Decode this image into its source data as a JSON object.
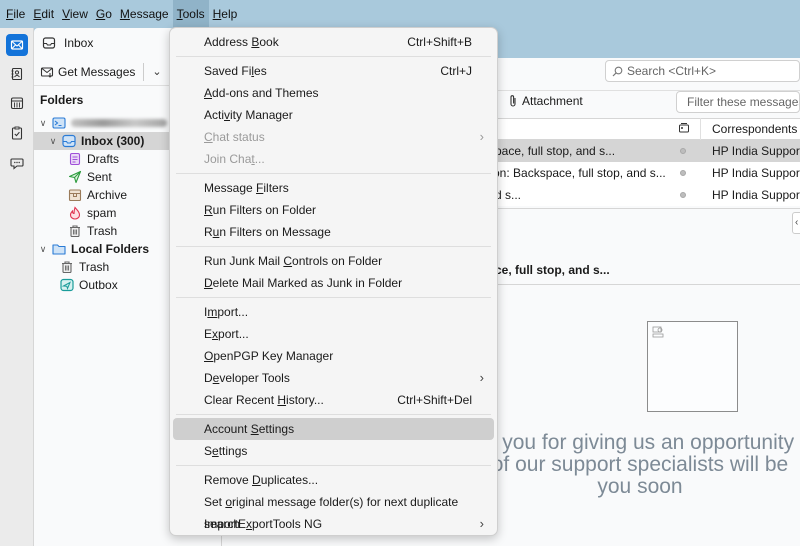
{
  "menubar": {
    "items": [
      {
        "label": "File",
        "mnemonic": "F"
      },
      {
        "label": "Edit",
        "mnemonic": "E"
      },
      {
        "label": "View",
        "mnemonic": "V"
      },
      {
        "label": "Go",
        "mnemonic": "G"
      },
      {
        "label": "Message",
        "mnemonic": "M"
      },
      {
        "label": "Tools",
        "mnemonic": "T"
      },
      {
        "label": "Help",
        "mnemonic": "H"
      }
    ],
    "active": "Tools"
  },
  "spaces": [
    {
      "name": "mail-icon",
      "active": true
    },
    {
      "name": "address-book-icon",
      "active": false
    },
    {
      "name": "calendar-icon",
      "active": false
    },
    {
      "name": "tasks-icon",
      "active": false
    },
    {
      "name": "chat-icon",
      "active": false
    }
  ],
  "tab": {
    "label": "Inbox",
    "icon": "inbox-icon"
  },
  "toolbar": {
    "get_messages": "Get Messages"
  },
  "folder_pane": {
    "header": "Folders",
    "account": {
      "name": "[redacted email]",
      "blurred": true
    },
    "folders": [
      {
        "label": "Inbox (300)",
        "icon": "inbox-icon",
        "level": 1,
        "bold": true,
        "selected": true,
        "expanded": true
      },
      {
        "label": "Drafts",
        "icon": "drafts-icon",
        "level": 2
      },
      {
        "label": "Sent",
        "icon": "sent-icon",
        "level": 2
      },
      {
        "label": "Archive",
        "icon": "archive-icon",
        "level": 2
      },
      {
        "label": "spam",
        "icon": "spam-icon",
        "level": 2
      },
      {
        "label": "Trash",
        "icon": "trash-icon",
        "level": 2
      }
    ],
    "local_folders": {
      "label": "Local Folders",
      "children": [
        {
          "label": "Trash",
          "icon": "trash-icon"
        },
        {
          "label": "Outbox",
          "icon": "outbox-icon"
        }
      ]
    }
  },
  "search": {
    "placeholder": "Search <Ctrl+K>"
  },
  "quick_filter": {
    "attachment_label": "Attachment",
    "filter_placeholder": "Filter these messages <Ctrl+Shift+K>"
  },
  "thread_pane": {
    "columns": {
      "correspondents": "Correspondents"
    },
    "rows": [
      {
        "subject": "pace, full stop, and s...",
        "correspondent": "HP India Support",
        "selected": true
      },
      {
        "subject": "on: Backspace, full stop, and s...",
        "correspondent": "HP India Support",
        "selected": false
      },
      {
        "subject": "d s...",
        "correspondent": "HP India Support",
        "selected": false
      }
    ]
  },
  "message": {
    "subject_partial": "ce, full stop, and s...",
    "body_lines": [
      "k you for giving us an opportunity",
      "of our support specialists will be",
      "you soon"
    ]
  },
  "tools_menu": {
    "groups": [
      [
        {
          "label": "Address Book",
          "shortcut": "Ctrl+Shift+B",
          "mn": "B"
        }
      ],
      [
        {
          "label": "Saved Files",
          "shortcut": "Ctrl+J",
          "mn": "l"
        },
        {
          "label": "Add-ons and Themes",
          "mn": "A"
        },
        {
          "label": "Activity Manager",
          "mn": "v"
        },
        {
          "label": "Chat status",
          "disabled": true,
          "submenu": true,
          "mn": "C"
        },
        {
          "label": "Join Chat...",
          "disabled": true,
          "mn": "t"
        }
      ],
      [
        {
          "label": "Message Filters",
          "mn": "F"
        },
        {
          "label": "Run Filters on Folder",
          "mn": "R"
        },
        {
          "label": "Run Filters on Message",
          "mn": "u"
        }
      ],
      [
        {
          "label": "Run Junk Mail Controls on Folder",
          "mn": "C"
        },
        {
          "label": "Delete Mail Marked as Junk in Folder",
          "mn": "D"
        }
      ],
      [
        {
          "label": "Import...",
          "mn": "m"
        },
        {
          "label": "Export...",
          "mn": "x"
        },
        {
          "label": "OpenPGP Key Manager",
          "mn": "O"
        },
        {
          "label": "Developer Tools",
          "submenu": true,
          "mn": "e"
        },
        {
          "label": "Clear Recent History...",
          "shortcut": "Ctrl+Shift+Del",
          "mn": "H"
        }
      ],
      [
        {
          "label": "Account Settings",
          "highlighted": true,
          "mn": "S"
        },
        {
          "label": "Settings",
          "mn": "e"
        }
      ],
      [
        {
          "label": "Remove Duplicates...",
          "mn": "D"
        },
        {
          "label": "Set original message folder(s) for next duplicate search",
          "mn": "o"
        },
        {
          "label": "ImportExportTools NG",
          "submenu": true,
          "mn": "x"
        }
      ]
    ]
  },
  "colors": {
    "titlebar": "#a9c9dc",
    "accent": "#1373d9",
    "menu_highlight": "#cfcfcf",
    "selection": "#d5d5d5",
    "body_text": "#7d8a96"
  }
}
